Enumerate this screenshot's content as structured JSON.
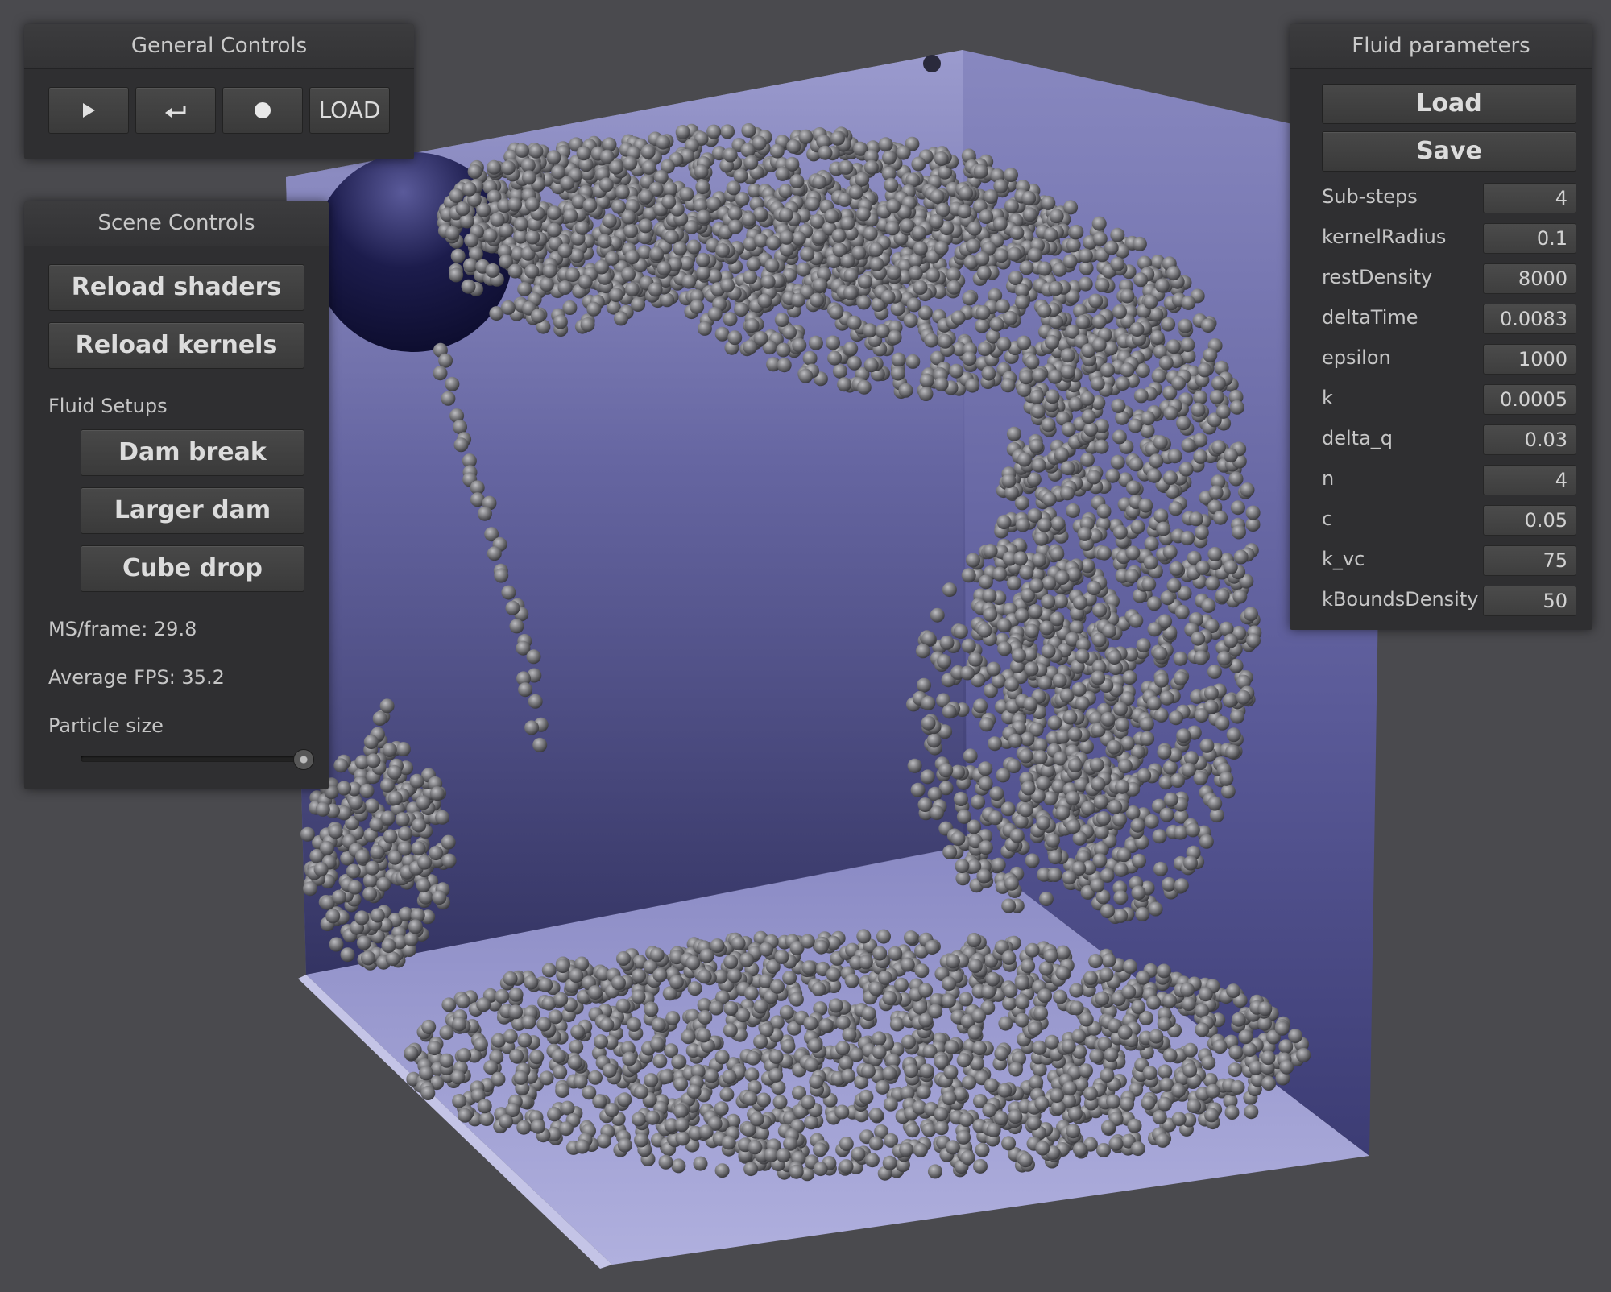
{
  "colors": {
    "background": "#4a4a4e",
    "panel": "#2f2f31",
    "particle": "#7b7b7f",
    "box_back": "#5a5a9a",
    "box_side": "#7e7eb6",
    "box_floor": "#a4a4d2",
    "sphere": "#1a1a48"
  },
  "general_controls": {
    "title": "General Controls",
    "play_icon": "play-icon",
    "reset_icon": "undo-arrow-icon",
    "record_icon": "record-dot-icon",
    "load_label": "LOAD"
  },
  "scene_controls": {
    "title": "Scene Controls",
    "reload_shaders": "Reload shaders",
    "reload_kernels": "Reload kernels",
    "fluid_setups_label": "Fluid Setups",
    "setups": [
      "Dam break",
      "Larger dam break",
      "Cube drop"
    ],
    "ms_frame": "MS/frame: 29.8",
    "avg_fps": "Average FPS: 35.2",
    "particle_size_label": "Particle size",
    "particle_size_fraction": 1.0
  },
  "fluid_parameters": {
    "title": "Fluid parameters",
    "load_label": "Load",
    "save_label": "Save",
    "params": [
      {
        "name": "Sub-steps",
        "value": "4"
      },
      {
        "name": "kernelRadius",
        "value": "0.1"
      },
      {
        "name": "restDensity",
        "value": "8000"
      },
      {
        "name": "deltaTime",
        "value": "0.0083"
      },
      {
        "name": "epsilon",
        "value": "1000"
      },
      {
        "name": "k",
        "value": "0.0005"
      },
      {
        "name": "delta_q",
        "value": "0.03"
      },
      {
        "name": "n",
        "value": "4"
      },
      {
        "name": "c",
        "value": "0.05"
      },
      {
        "name": "k_vc",
        "value": "75"
      },
      {
        "name": "kBoundsDensity",
        "value": "50"
      }
    ]
  }
}
